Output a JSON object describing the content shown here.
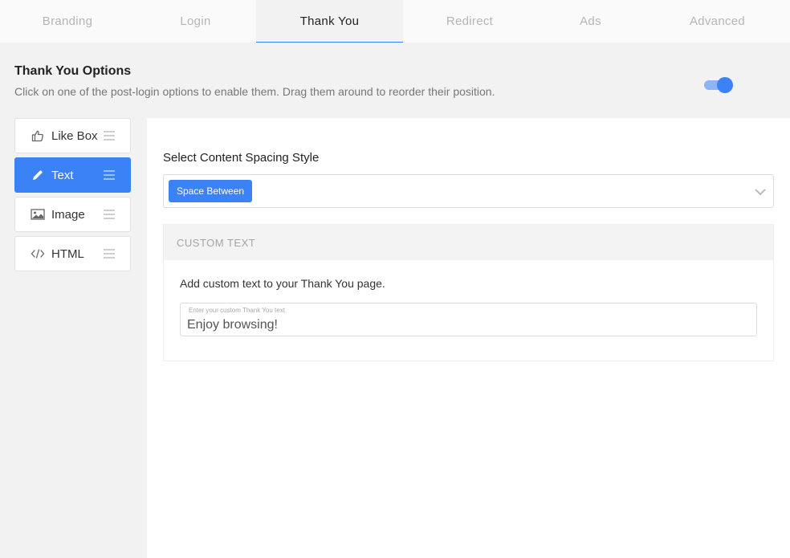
{
  "tabs": [
    {
      "label": "Branding"
    },
    {
      "label": "Login"
    },
    {
      "label": "Thank You"
    },
    {
      "label": "Redirect"
    },
    {
      "label": "Ads"
    },
    {
      "label": "Advanced"
    }
  ],
  "active_tab": "Thank You",
  "options": {
    "title": "Thank You Options",
    "description": "Click on one of the post-login options to enable them. Drag them around to reorder their position.",
    "toggle_on": true
  },
  "sidebar": {
    "items": [
      {
        "label": "Like Box",
        "icon": "thumbs-up-icon",
        "active": false
      },
      {
        "label": "Text",
        "icon": "pencil-icon",
        "active": true
      },
      {
        "label": "Image",
        "icon": "image-icon",
        "active": false
      },
      {
        "label": "HTML",
        "icon": "code-icon",
        "active": false
      }
    ]
  },
  "content": {
    "spacing_label": "Select Content Spacing Style",
    "spacing_value": "Space Between",
    "custom_text": {
      "header": "CUSTOM TEXT",
      "description": "Add custom text to your Thank You page.",
      "input_caption": "Enter your custom Thank You text",
      "input_value": "Enjoy browsing!"
    }
  },
  "colors": {
    "accent": "#3b82f6",
    "toggle_track": "#8fb4f5",
    "background": "#f2f2f2"
  }
}
